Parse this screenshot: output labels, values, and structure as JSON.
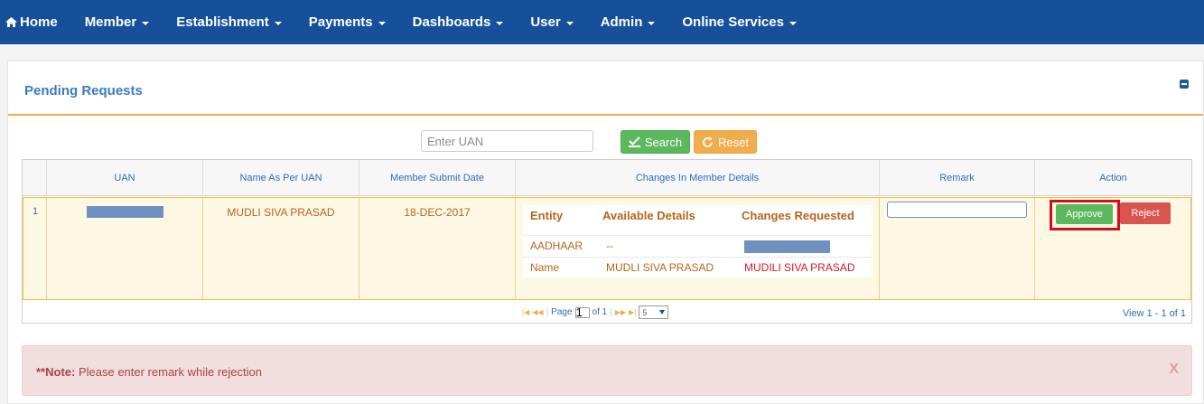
{
  "nav": {
    "home": "Home",
    "items": [
      "Member",
      "Establishment",
      "Payments",
      "Dashboards",
      "User",
      "Admin",
      "Online Services"
    ]
  },
  "panel": {
    "title": "Pending Requests"
  },
  "search": {
    "placeholder": "Enter UAN",
    "search_label": "Search",
    "reset_label": "Reset"
  },
  "grid": {
    "columns": [
      "UAN",
      "Name As Per UAN",
      "Member Submit Date",
      "Changes In Member Details",
      "Remark",
      "Action"
    ],
    "rows": [
      {
        "num": "1",
        "name": "MUDLI SIVA PRASAD",
        "date": "18-DEC-2017",
        "changes": {
          "headers": [
            "Entity",
            "Available Details",
            "Changes Requested"
          ],
          "items": [
            {
              "entity": "AADHAAR",
              "available": "--",
              "requested": ""
            },
            {
              "entity": "Name",
              "available": "MUDLI SIVA PRASAD",
              "requested": "MUDILI SIVA PRASAD"
            }
          ]
        },
        "remark": "",
        "approve_label": "Approve",
        "reject_label": "Reject"
      }
    ]
  },
  "pager": {
    "page_label": "Page",
    "page_value": "1",
    "of_label": "of 1",
    "page_size": "5",
    "view_info": "View 1 - 1 of 1"
  },
  "note": {
    "prefix": "**Note:",
    "text": " Please enter remark while rejection",
    "close": "X"
  },
  "colors": {
    "navbar": "#16509a",
    "accent_border": "#f0ad4e",
    "approve": "#5cb85c",
    "reject": "#d9534f"
  }
}
